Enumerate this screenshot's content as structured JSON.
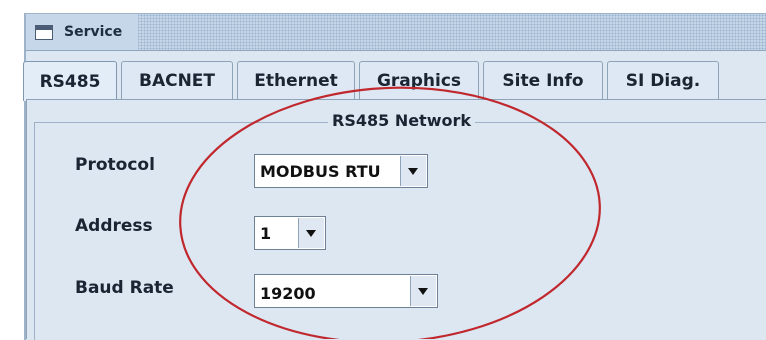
{
  "window": {
    "title": "Service",
    "icon": "window-icon"
  },
  "tabs": [
    {
      "label": "RS485",
      "active": true
    },
    {
      "label": "BACNET",
      "active": false
    },
    {
      "label": "Ethernet",
      "active": false
    },
    {
      "label": "Graphics",
      "active": false
    },
    {
      "label": "Site Info",
      "active": false
    },
    {
      "label": "SI Diag.",
      "active": false
    }
  ],
  "group": {
    "title": "RS485 Network"
  },
  "fields": {
    "protocol": {
      "label": "Protocol",
      "value": "MODBUS RTU"
    },
    "address": {
      "label": "Address",
      "value": "1"
    },
    "baud_rate": {
      "label": "Baud Rate",
      "value": "19200"
    }
  },
  "colors": {
    "annotation_circle": "#c0282d"
  }
}
